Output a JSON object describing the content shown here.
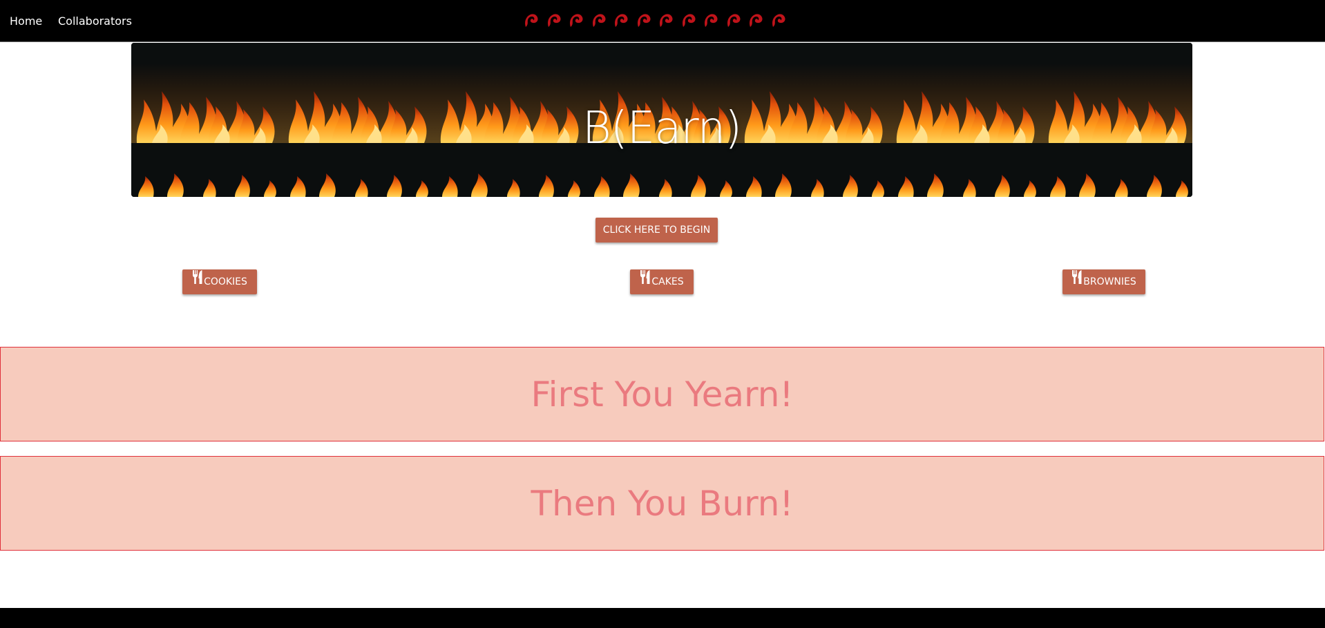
{
  "nav": {
    "home_label": "Home",
    "collaborators_label": "Collaborators",
    "flame_icon_count": 12,
    "flame_icon_color": "#c0131a"
  },
  "hero": {
    "title": "B(Earn)"
  },
  "actions": {
    "begin_label": "CLICK HERE TO BEGIN",
    "categories": [
      {
        "label": "COOKIES",
        "icon": "utensils-icon"
      },
      {
        "label": "CAKES",
        "icon": "utensils-icon"
      },
      {
        "label": "BROWNIES",
        "icon": "utensils-icon"
      }
    ]
  },
  "banners": [
    {
      "text": "First You Yearn!"
    },
    {
      "text": "Then You Burn!"
    }
  ],
  "colors": {
    "nav_background": "#000000",
    "button_background": "#bf634b",
    "banner_background": "#f7cbbd",
    "banner_border": "#e0303a",
    "banner_text": "#ea7a7f",
    "flame_orange": "#ff8a10"
  }
}
